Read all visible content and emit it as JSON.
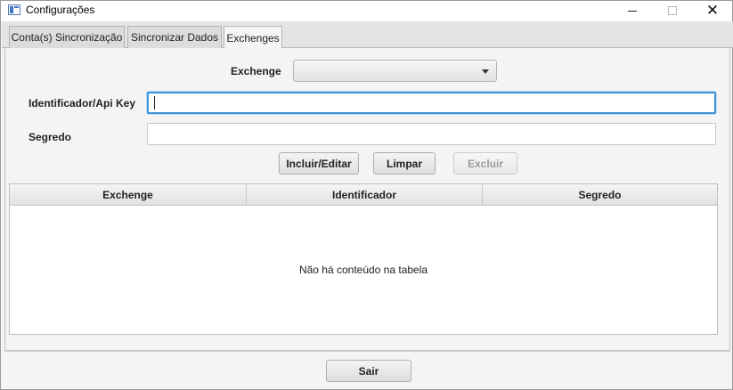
{
  "window": {
    "title": "Configurações",
    "icon": "app-window-icon",
    "controls": {
      "minimize": "minimize-icon",
      "maximize": "maximize-icon",
      "close": "✕"
    }
  },
  "tabs": [
    {
      "label": "Conta(s) Sincronização",
      "selected": false
    },
    {
      "label": "Sincronizar Dados",
      "selected": false
    },
    {
      "label": "Exchenges",
      "selected": true
    }
  ],
  "form": {
    "exchange_label": "Exchenge",
    "exchange_value": "",
    "identifier_label": "Identificador/Api Key",
    "identifier_value": "",
    "secret_label": "Segredo",
    "secret_value": ""
  },
  "buttons": {
    "include_edit": "Incluir/Editar",
    "clear": "Limpar",
    "delete": "Excluir",
    "exit": "Sair"
  },
  "table": {
    "columns": [
      "Exchenge",
      "Identificador",
      "Segredo"
    ],
    "rows": [],
    "empty_message": "Não há conteúdo na tabela"
  },
  "colors": {
    "focus_accent": "#3e94d6",
    "disabled_text": "#9c9c9c"
  }
}
